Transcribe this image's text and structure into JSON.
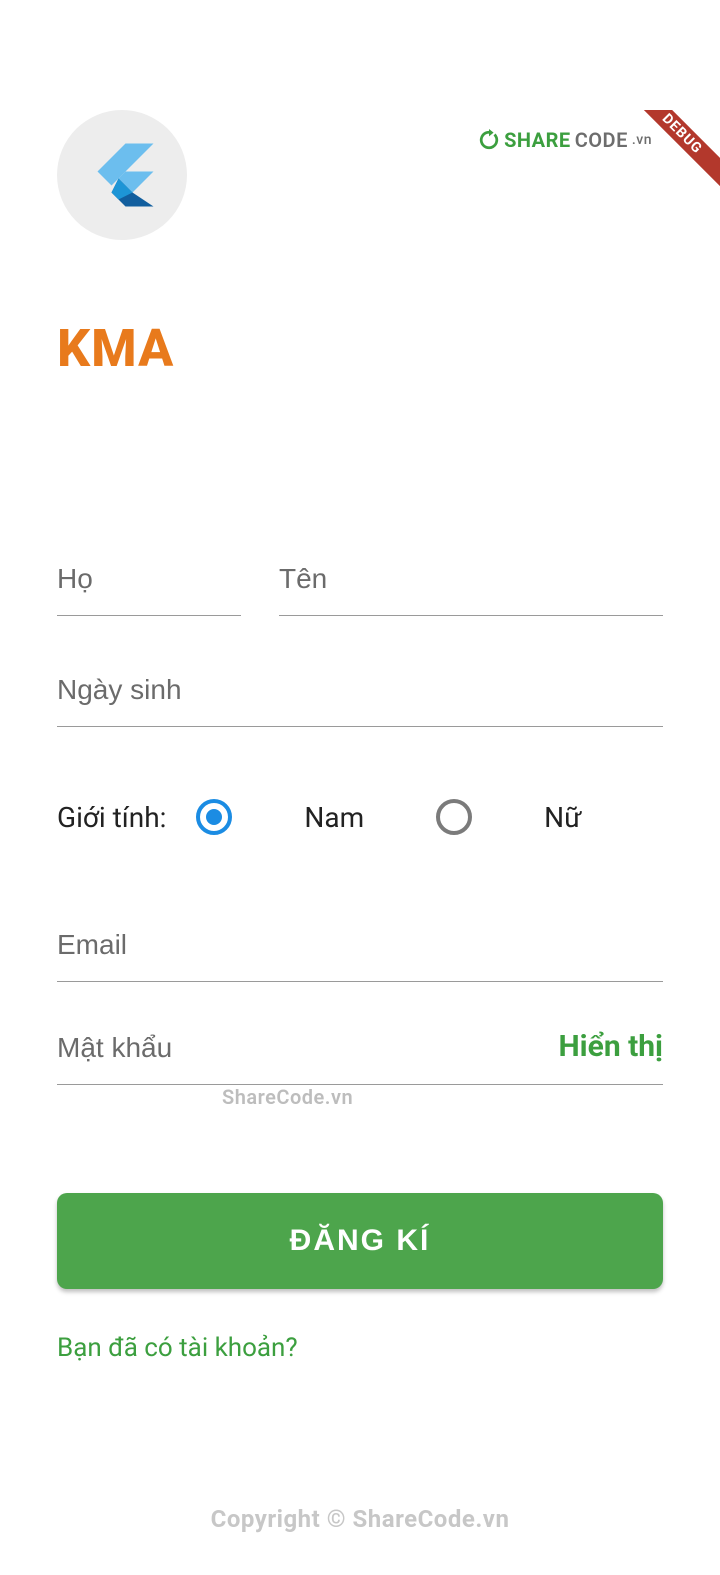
{
  "watermark": {
    "top_share": "SHARE",
    "top_code": "CODE",
    "top_vn": ".vn",
    "center": "ShareCode.vn",
    "footer": "Copyright © ShareCode.vn"
  },
  "debug_ribbon": "DEBUG",
  "app": {
    "title": "KMA"
  },
  "form": {
    "last_name_placeholder": "Họ",
    "first_name_placeholder": "Tên",
    "dob_placeholder": "Ngày sinh",
    "gender_label": "Giới tính:",
    "gender_male": "Nam",
    "gender_female": "Nữ",
    "gender_selected": "male",
    "email_placeholder": "Email",
    "password_placeholder": "Mật khẩu",
    "show_password_label": "Hiển thị",
    "register_button": "ĐĂNG KÍ",
    "login_link": "Bạn đã có tài khoản?"
  },
  "colors": {
    "accent_orange": "#E87A1C",
    "primary_green": "#4DA54C",
    "link_green": "#3C9F3F",
    "radio_blue": "#1B8CE3"
  }
}
